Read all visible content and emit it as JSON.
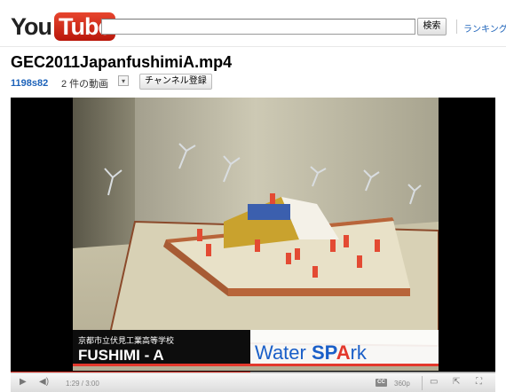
{
  "header": {
    "logo_you": "You",
    "logo_tube": "Tube",
    "search_value": "",
    "search_button": "検索",
    "ranking_link": "ランキング"
  },
  "video": {
    "title": "GEC2011JapanfushimiA.mp4",
    "uploader": "1198s82",
    "videos_count": "2 件の動画",
    "dropdown_icon": "chevron-down-icon",
    "subscribe_button": "チャンネル登録",
    "overlay": {
      "school_name": "京都市立伏見工業高等学校",
      "team_name": "FUSHIMI - A",
      "project_prefix": "Water ",
      "project_sp": "SP",
      "project_a": "A",
      "project_rk": "rk"
    }
  },
  "controls": {
    "time": "1:29 / 3:00",
    "cc_label": "CC",
    "quality": "360p",
    "progress": 0.494
  },
  "colors": {
    "accent_red": "#e3382c",
    "link_blue": "#1c62b9",
    "project_blue": "#1a5fc8"
  }
}
